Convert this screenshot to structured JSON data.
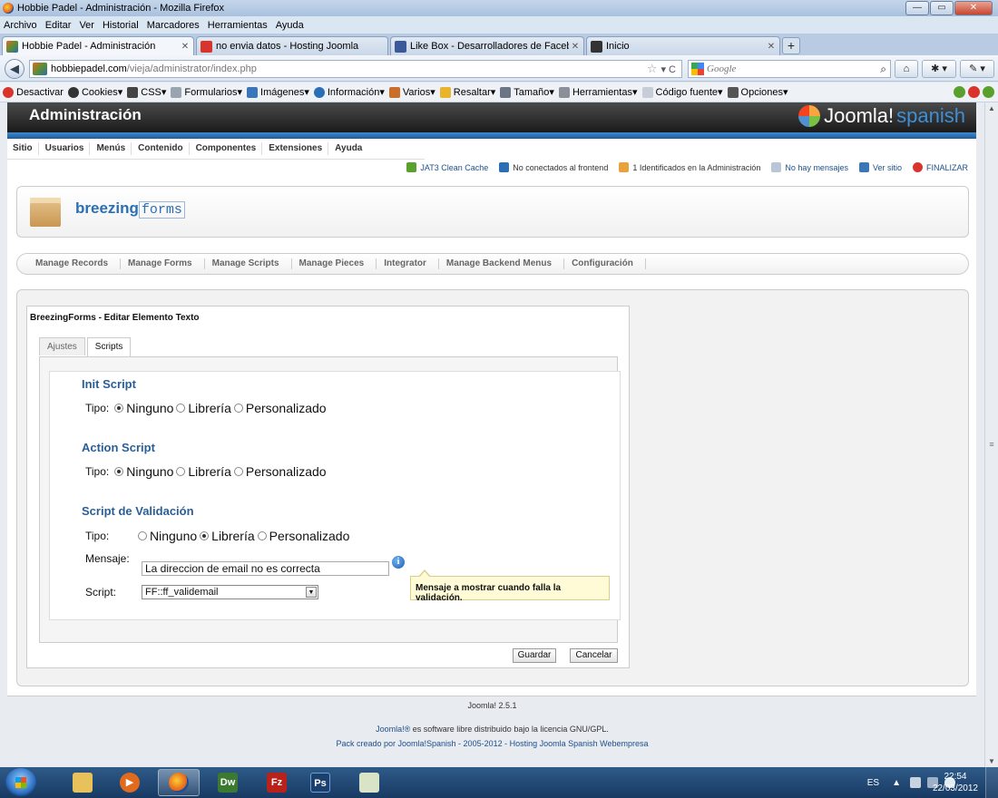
{
  "window": {
    "title": "Hobbie Padel - Administración - Mozilla Firefox"
  },
  "menubar": [
    "Archivo",
    "Editar",
    "Ver",
    "Historial",
    "Marcadores",
    "Herramientas",
    "Ayuda"
  ],
  "tabs": [
    {
      "label": "Hobbie Padel - Administración",
      "favicon": "joomla-icon",
      "color": "#e2672a"
    },
    {
      "label": "no envia datos - Hosting Joomla",
      "favicon": "webempresa-icon",
      "color": "#d9342b"
    },
    {
      "label": "Like Box - Desarrolladores de Facebook",
      "favicon": "facebook-icon",
      "color": "#3b5998"
    },
    {
      "label": "Inicio",
      "favicon": "joomla-icon",
      "color": "#333333"
    }
  ],
  "newtab_label": "+",
  "navbar": {
    "url_host": "hobbiepadel.com",
    "url_path": "/vieja/administrator/index.php",
    "search_placeholder": "Google"
  },
  "devbar": [
    "Desactivar",
    "Cookies",
    "CSS",
    "Formularios",
    "Imágenes",
    "Información",
    "Varios",
    "Resaltar",
    "Tamaño",
    "Herramientas",
    "Código fuente",
    "Opciones"
  ],
  "joomla": {
    "admin_title": "Administración",
    "logo_text": "Joomla!",
    "logo_suffix": "spanish",
    "menu": [
      "Sitio",
      "Usuarios",
      "Menús",
      "Contenido",
      "Componentes",
      "Extensiones",
      "Ayuda"
    ],
    "status": [
      {
        "label": "JAT3 Clean Cache",
        "link": true
      },
      {
        "label": "No conectados al frontend",
        "link": false
      },
      {
        "label": "1 Identificados en la Administración",
        "link": false
      },
      {
        "label": "No hay mensajes",
        "link": true
      },
      {
        "label": "Ver sitio",
        "link": true
      },
      {
        "label": "FINALIZAR",
        "link": true
      }
    ]
  },
  "bf": {
    "logo_bold": "breezing",
    "logo_light": "forms",
    "submenu": [
      "Manage Records",
      "Manage Forms",
      "Manage Scripts",
      "Manage Pieces",
      "Integrator",
      "Manage Backend Menus",
      "Configuración"
    ]
  },
  "form": {
    "title": "BreezingForms - Editar Elemento Texto",
    "tabs": [
      "Ajustes",
      "Scripts"
    ],
    "tipo_label": "Tipo:",
    "options": [
      "Ninguno",
      "Librería",
      "Personalizado"
    ],
    "init_title": "Init Script",
    "action_title": "Action Script",
    "validation_title": "Script de Validación",
    "mensaje_label": "Mensaje:",
    "mensaje_value": "La direccion de email no es correcta",
    "tooltip": "Mensaje a mostrar cuando falla la validación.",
    "script_label": "Script:",
    "script_value": "FF::ff_validemail",
    "save": "Guardar",
    "cancel": "Cancelar"
  },
  "footer": {
    "version": "Joomla! 2.5.1",
    "license_link": "Joomla!®",
    "license_text": " es software libre distribuido bajo la licencia GNU/GPL.",
    "pack": "Pack creado por Joomla!Spanish - 2005-2012 - Hosting Joomla Spanish Webempresa"
  },
  "taskbar": {
    "apps": [
      "Explorer",
      "Media Player",
      "Firefox",
      "Dw",
      "Fz",
      "Ps",
      "Notepad"
    ],
    "lang": "ES",
    "time": "22:54",
    "date": "22/03/2012"
  }
}
